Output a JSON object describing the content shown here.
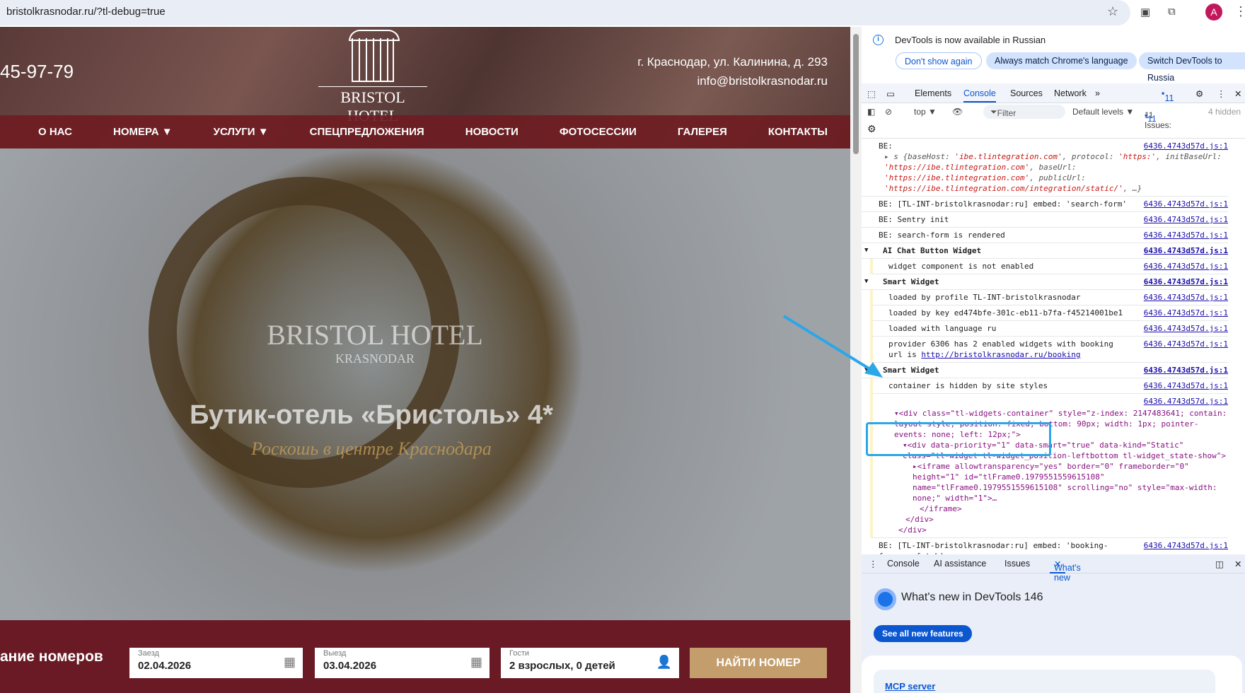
{
  "browser": {
    "url": "bristolkrasnodar.ru/?tl-debug=true",
    "avatar": "A"
  },
  "site": {
    "phone": "45-97-79",
    "logo": {
      "name": "BRISTOL HOTEL",
      "city": "KRASNODAR"
    },
    "address": "г. Краснодар, ул. Калинина, д. 293",
    "email": "info@bristolkrasnodar.ru",
    "nav": [
      "О НАС",
      "НОМЕРА ▼",
      "УСЛУГИ ▼",
      "СПЕЦПРЕДЛОЖЕНИЯ",
      "НОВОСТИ",
      "ФОТОСЕССИИ",
      "ГАЛЕРЕЯ",
      "КОНТАКТЫ"
    ],
    "hero": {
      "title": "Бутик-отель «Бристоль» 4*",
      "subtitle": "Роскошь в центре Краснодара"
    },
    "booking": {
      "title": "ание номеров",
      "checkin_label": "Заезд",
      "checkin": "02.04.2026",
      "checkout_label": "Выезд",
      "checkout": "03.04.2026",
      "guests_label": "Гости",
      "guests": "2 взрослых, 0 детей",
      "button": "НАЙТИ НОМЕР"
    }
  },
  "devtools": {
    "infobar": {
      "message": "DevTools is now available in Russian",
      "btn1": "Don't show again",
      "btn2": "Always match Chrome's language",
      "btn3": "Switch DevTools to Russia"
    },
    "tabs": [
      "Elements",
      "Console",
      "Sources",
      "Network"
    ],
    "issues_badge": "11",
    "toolbar": {
      "context": "top ▼",
      "filter": "Filter",
      "levels": "Default levels ▼",
      "issues": "11 Issues:",
      "issues_count": "11",
      "hidden": "4 hidden"
    },
    "src": "6436.4743d57d.js:1",
    "log": {
      "be": "BE:",
      "obj1": "s {baseHost: ",
      "obj1s": "'ibe.tlintegration.com'",
      "obj2": ", protocol: ",
      "obj2s": "'https:'",
      "obj3": ", initBaseUrl: ",
      "obj3s": "'https://ibe.tlintegration.com'",
      "obj4": ", baseUrl: ",
      "obj4s": "'https://ibe.tlintegration.com'",
      "obj5": ", publicUrl: ",
      "obj5s": "'https://ibe.tlintegration.com/integration/static/'",
      "obj6": ", …}",
      "l2": "BE: [TL-INT-bristolkrasnodar:ru] embed: 'search-form'",
      "l3": "BE: Sentry init",
      "l4": "BE: search-form is rendered",
      "g1": "AI Chat Button Widget",
      "g1a": "widget component is not enabled",
      "g2": "Smart Widget",
      "g2a": "loaded by profile TL-INT-bristolkrasnodar",
      "g2b": "loaded by key ed474bfe-301c-eb11-b7fa-f45214001be1",
      "g2c": "loaded with language ru",
      "g2d": "provider 6306 has 2 enabled widgets with booking url is ",
      "g2d_link": "http://bristolkrasnodar.ru/booking",
      "g3": "Smart Widget",
      "g3a": "container is hidden by site styles",
      "el1": "<div class=\"tl-widgets-container\" style=\"z-index: 2147483641; contain: layout style; position: fixed; bottom: 90px; width: 1px; pointer-events: none; left: 12px;\">",
      "el2": "<div data-priority=\"1\" data-smart=\"true\" data-kind=\"Static\" class=\"tl-widget tl-widget_position-leftbottom tl-widget_state-show\">",
      "el3": "<iframe allowtransparency=\"yes\" border=\"0\" frameborder=\"0\" height=\"1\" id=\"tlFrame0.1979551559615108\" name=\"tlFrame0.1979551559615108\" scrolling=\"no\" style=\"max-width: none;\" width=\"1\">…",
      "el4": "</iframe>",
      "el5": "</div>",
      "el6": "</div>",
      "l5": "BE: [TL-INT-bristolkrasnodar:ru] embed: 'booking-form-prefetch'"
    },
    "drawer": {
      "tabs": [
        "Console",
        "AI assistance",
        "Issues",
        "What's new"
      ],
      "title": "What's new in DevTools 146",
      "button": "See all new features",
      "card_link": "MCP server"
    }
  }
}
